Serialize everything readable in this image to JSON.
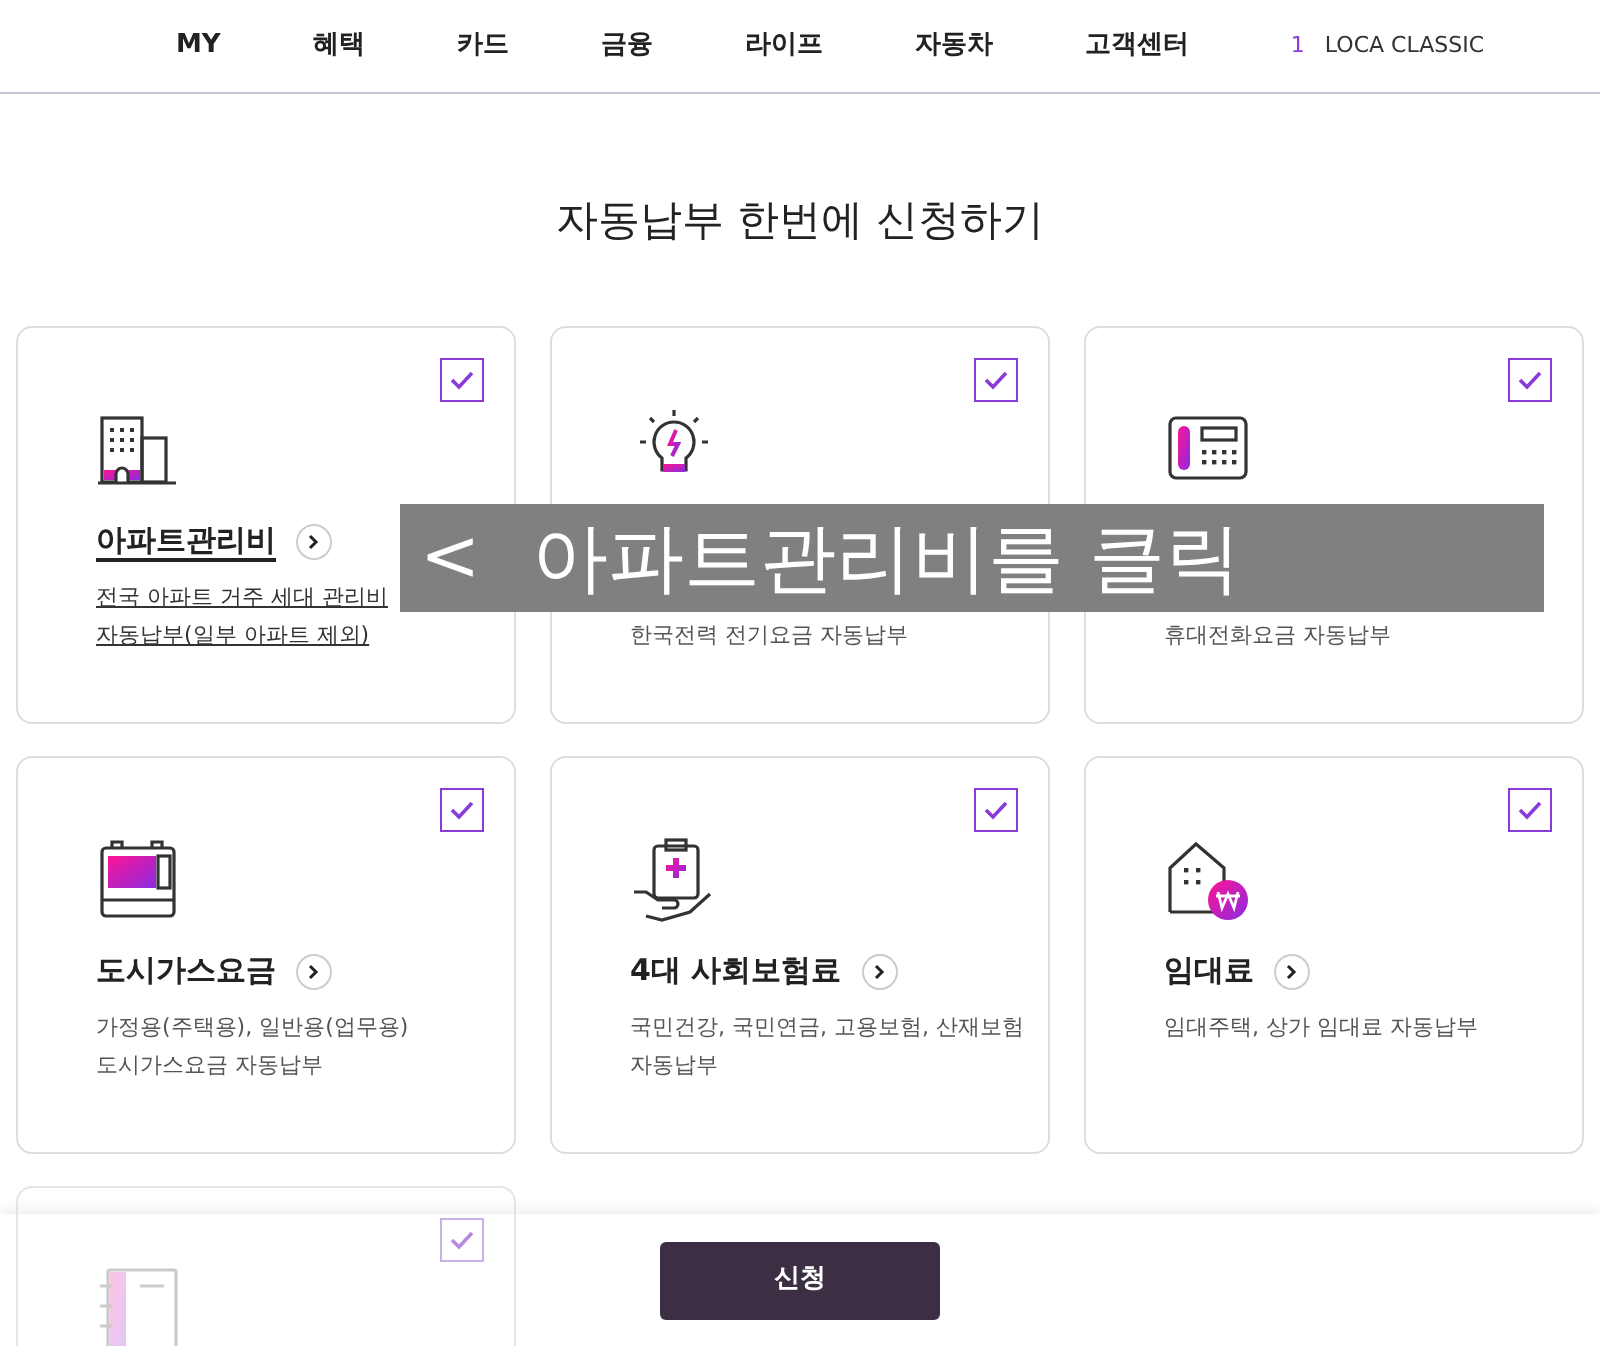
{
  "nav": {
    "items": [
      "MY",
      "혜택",
      "카드",
      "금융",
      "라이프",
      "자동차",
      "고객센터"
    ],
    "count": "1",
    "account": "LOCA CLASSIC"
  },
  "title": "자동납부 한번에 신청하기",
  "cards": [
    {
      "kind": "building",
      "title": "아파트관리비",
      "description": [
        "전국 아파트 거주 세대 관리비",
        "자동납부(일부 아파트 제외)"
      ],
      "checked": true,
      "highlighted": true
    },
    {
      "kind": "bulb",
      "description": [
        "한국전력 전기요금 자동납부"
      ],
      "checked": true
    },
    {
      "kind": "phone",
      "description": [
        "휴대전화요금 자동납부"
      ],
      "checked": true
    },
    {
      "kind": "gas",
      "title": "도시가스요금",
      "description": [
        "가정용(주택용), 일반용(업무용)",
        "도시가스요금 자동납부"
      ],
      "checked": true,
      "highlighted": false
    },
    {
      "kind": "insurance",
      "title": "4대 사회보험료",
      "description": [
        "국민건강, 국민연금, 고용보험, 산재보험",
        "자동납부"
      ],
      "checked": true,
      "highlighted": false
    },
    {
      "kind": "house",
      "title": "임대료",
      "description": [
        "임대주택, 상가 임대료 자동납부"
      ],
      "checked": true,
      "highlighted": false
    },
    {
      "kind": "notebook",
      "checked": true,
      "dimmed": true
    }
  ],
  "submit": "신청",
  "caption": {
    "arrow": "<",
    "text": "아파트관리비를 클릭"
  }
}
